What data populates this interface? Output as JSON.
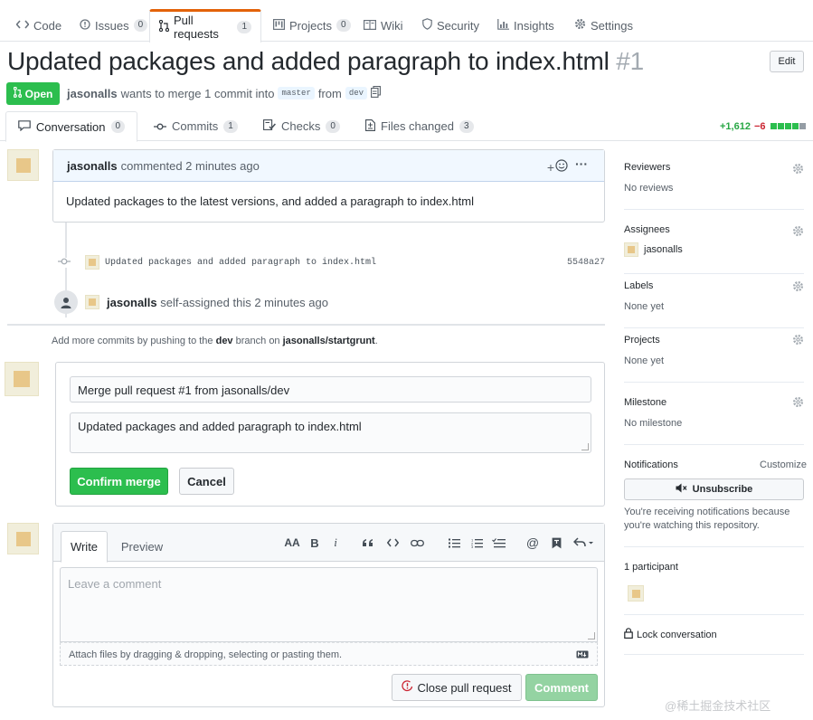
{
  "repo_nav": {
    "tabs": [
      {
        "label": "Code",
        "count": null
      },
      {
        "label": "Issues",
        "count": "0"
      },
      {
        "label": "Pull requests",
        "count": "1"
      },
      {
        "label": "Projects",
        "count": "0"
      },
      {
        "label": "Wiki",
        "count": null
      },
      {
        "label": "Security",
        "count": null
      },
      {
        "label": "Insights",
        "count": null
      },
      {
        "label": "Settings",
        "count": null
      }
    ]
  },
  "pr": {
    "title": "Updated packages and added paragraph to index.html",
    "number": "#1",
    "edit_label": "Edit",
    "state": "Open",
    "author": "jasonalls",
    "merge_text": "wants to merge 1 commit into",
    "base_branch": "master",
    "from_text": "from",
    "head_branch": "dev"
  },
  "pr_tabs": [
    {
      "label": "Conversation",
      "count": "0"
    },
    {
      "label": "Commits",
      "count": "1"
    },
    {
      "label": "Checks",
      "count": "0"
    },
    {
      "label": "Files changed",
      "count": "3"
    }
  ],
  "diffstat": {
    "additions": "+1,612",
    "deletions": "−6"
  },
  "comment": {
    "author": "jasonalls",
    "action": "commented 2 minutes ago",
    "reaction_label": "+",
    "menu_label": "···",
    "body": "Updated packages to the latest versions, and added a paragraph to index.html"
  },
  "commit": {
    "message": "Updated packages and added paragraph to index.html",
    "sha": "5548a27"
  },
  "event": {
    "actor": "jasonalls",
    "text": "self-assigned this 2 minutes ago"
  },
  "hint": {
    "prefix": "Add more commits by pushing to the",
    "branch": "dev",
    "middle": "branch on",
    "repo": "jasonalls/startgrunt",
    "suffix": "."
  },
  "merge": {
    "title_value": "Merge pull request #1 from jasonalls/dev",
    "body_value": "Updated packages and added paragraph to index.html",
    "confirm_label": "Confirm merge",
    "cancel_label": "Cancel"
  },
  "new_comment": {
    "write_tab": "Write",
    "preview_tab": "Preview",
    "toolbar": [
      "AA",
      "B",
      "i",
      "““",
      "<>",
      "link",
      "ul",
      "ol",
      "task",
      "@",
      "saved",
      "reply"
    ],
    "placeholder": "Leave a comment",
    "attach_text": "Attach files by dragging & dropping, selecting or pasting them.",
    "close_label": "Close pull request",
    "comment_label": "Comment"
  },
  "sidebar": {
    "reviewers": {
      "heading": "Reviewers",
      "value": "No reviews"
    },
    "assignees": {
      "heading": "Assignees",
      "value": "jasonalls"
    },
    "labels": {
      "heading": "Labels",
      "value": "None yet"
    },
    "projects": {
      "heading": "Projects",
      "value": "None yet"
    },
    "milestone": {
      "heading": "Milestone",
      "value": "No milestone"
    },
    "notifications": {
      "heading": "Notifications",
      "customize": "Customize",
      "button": "Unsubscribe",
      "note": "You're receiving notifications because you're watching this repository."
    },
    "participants": {
      "heading": "1 participant"
    },
    "lock": "Lock conversation"
  },
  "watermark": "@稀土掘金技术社区",
  "colors": {
    "green": "#2cbe4e",
    "tab_accent": "#e36209",
    "link_blue": "#0366d6"
  }
}
